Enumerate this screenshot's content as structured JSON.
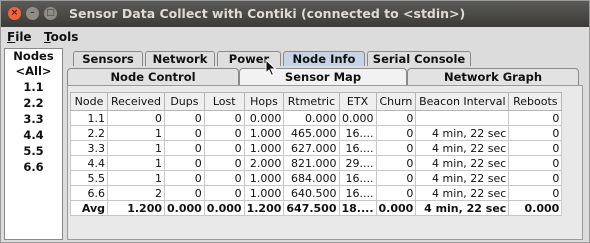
{
  "window": {
    "title": "Sensor Data Collect with Contiki (connected to <stdin>)",
    "buttons": [
      "×",
      "–",
      "□"
    ]
  },
  "menu": [
    {
      "label": "File",
      "accel": "F",
      "rest": "ile"
    },
    {
      "label": "Tools",
      "accel": "T",
      "rest": "ools"
    }
  ],
  "nodelist": {
    "header": "Nodes",
    "items": [
      "<All>",
      "1.1",
      "2.2",
      "3.3",
      "4.4",
      "5.5",
      "6.6"
    ]
  },
  "tabs_top": [
    {
      "label": "Sensors"
    },
    {
      "label": "Network"
    },
    {
      "label": "Power"
    },
    {
      "label": "Node Info",
      "selected": true
    },
    {
      "label": "Serial Console"
    }
  ],
  "tabs_sub": [
    {
      "label": "Node Control"
    },
    {
      "label": "Sensor Map",
      "selected": true
    },
    {
      "label": "Network Graph"
    }
  ],
  "table": {
    "columns": [
      "Node",
      "Received",
      "Dups",
      "Lost",
      "Hops",
      "Rtmetric",
      "ETX",
      "Churn",
      "Beacon Interval",
      "Reboots"
    ],
    "rows": [
      [
        "1.1",
        "0",
        "0",
        "0",
        "0.000",
        "0.000",
        "0.000",
        "0",
        "",
        "0"
      ],
      [
        "2.2",
        "1",
        "0",
        "0",
        "1.000",
        "465.000",
        "16....",
        "0",
        "4 min, 22 sec",
        "0"
      ],
      [
        "3.3",
        "1",
        "0",
        "0",
        "1.000",
        "627.000",
        "16....",
        "0",
        "4 min, 22 sec",
        "0"
      ],
      [
        "4.4",
        "1",
        "0",
        "0",
        "2.000",
        "821.000",
        "29....",
        "0",
        "4 min, 22 sec",
        "0"
      ],
      [
        "5.5",
        "1",
        "0",
        "0",
        "1.000",
        "684.000",
        "16....",
        "0",
        "4 min, 22 sec",
        "0"
      ],
      [
        "6.6",
        "2",
        "0",
        "0",
        "1.000",
        "640.500",
        "16....",
        "0",
        "4 min, 22 sec",
        "0"
      ]
    ],
    "avg": [
      "Avg",
      "1.200",
      "0.000",
      "0.000",
      "1.200",
      "647.500",
      "18....",
      "0.000",
      "4 min, 22 sec",
      "0.000"
    ]
  }
}
